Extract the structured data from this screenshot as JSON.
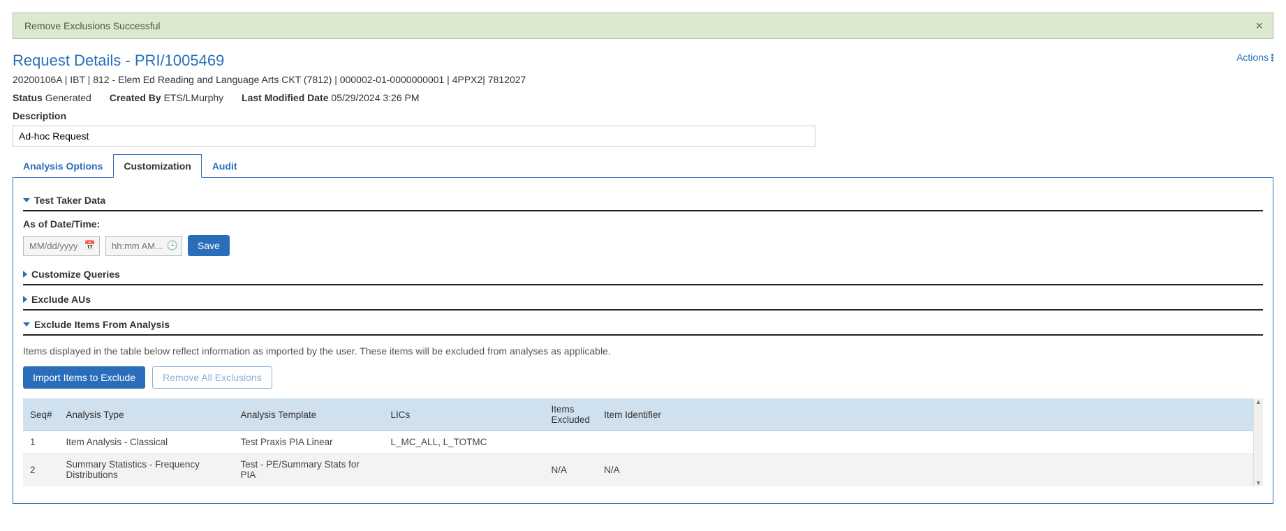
{
  "alert": {
    "message": "Remove Exclusions Successful"
  },
  "header": {
    "title": "Request Details - PRI/1005469",
    "actions_label": "Actions",
    "sub_line": "20200106A | IBT | 812 - Elem Ed Reading and Language Arts CKT (7812) | 000002-01-0000000001 | 4PPX2| 7812027"
  },
  "meta": {
    "status_label": "Status",
    "status_value": "Generated",
    "created_by_label": "Created By",
    "created_by_value": "ETS/LMurphy",
    "modified_label": "Last Modified Date",
    "modified_value": "05/29/2024 3:26 PM"
  },
  "description": {
    "label": "Description",
    "value": "Ad-hoc Request"
  },
  "tabs": {
    "analysis": "Analysis Options",
    "customization": "Customization",
    "audit": "Audit"
  },
  "sections": {
    "test_taker": {
      "title": "Test Taker Data",
      "asof_label": "As of Date/Time:",
      "date_placeholder": "MM/dd/yyyy",
      "time_placeholder": "hh:mm AM...",
      "save_label": "Save"
    },
    "customize_queries": {
      "title": "Customize Queries"
    },
    "exclude_aus": {
      "title": "Exclude AUs"
    },
    "exclude_items": {
      "title": "Exclude Items From Analysis",
      "hint": "Items displayed in the table below reflect information as imported by the user. These items will be excluded from analyses as applicable.",
      "import_label": "Import Items to Exclude",
      "remove_label": "Remove All Exclusions",
      "columns": {
        "seq": "Seq#",
        "analysis_type": "Analysis Type",
        "analysis_template": "Analysis Template",
        "lics": "LICs",
        "items_excluded": "Items Excluded",
        "item_identifier": "Item Identifier"
      },
      "rows": [
        {
          "seq": "1",
          "analysis_type": "Item Analysis - Classical",
          "analysis_template": "Test Praxis PIA Linear",
          "lics": "L_MC_ALL, L_TOTMC",
          "items_excluded": "",
          "item_identifier": ""
        },
        {
          "seq": "2",
          "analysis_type": "Summary Statistics - Frequency Distributions",
          "analysis_template": "Test - PE/Summary Stats for PIA",
          "lics": "",
          "items_excluded": "N/A",
          "item_identifier": "N/A"
        }
      ]
    }
  }
}
